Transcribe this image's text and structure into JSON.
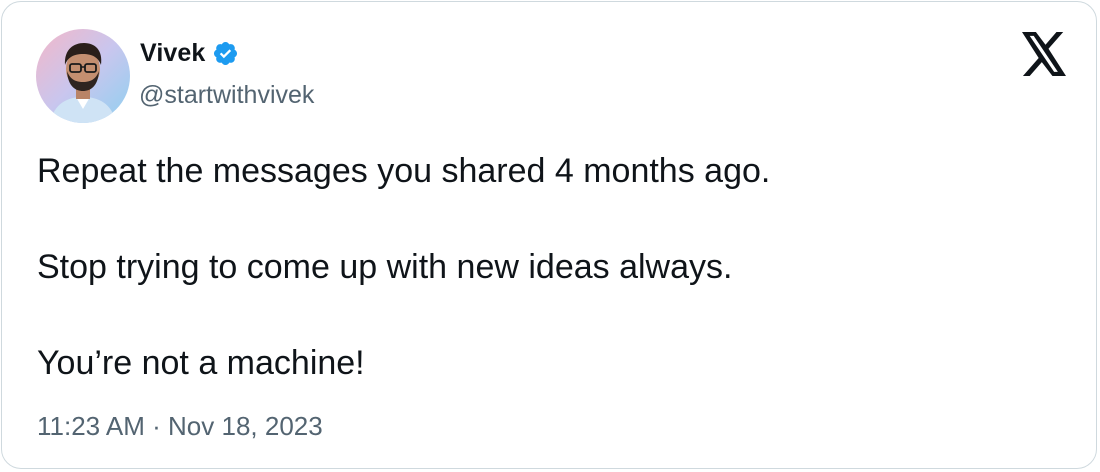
{
  "author": {
    "display_name": "Vivek",
    "handle": "@startwithvivek",
    "verified": true,
    "avatar_icon": "profile-photo",
    "badge_icon": "verified-badge-icon"
  },
  "brand": {
    "logo_icon": "x-logo-icon"
  },
  "tweet": {
    "lines": [
      "Repeat the messages you shared 4 months ago.",
      "Stop trying to come up with new ideas always.",
      "You’re not a machine!"
    ],
    "timestamp": "11:23 AM · Nov 18, 2023"
  },
  "colors": {
    "text": "#0f1419",
    "secondary": "#536471",
    "verified_blue": "#1d9bf0",
    "border": "#cfd9de"
  }
}
